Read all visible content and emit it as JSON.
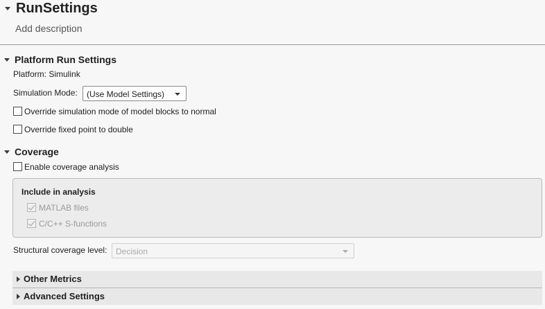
{
  "header": {
    "title": "RunSettings",
    "description": "Add description"
  },
  "platform_section": {
    "title": "Platform Run Settings",
    "platform_text": "Platform: Simulink",
    "simulation_mode_label": "Simulation Mode:",
    "simulation_mode_value": "(Use Model Settings)",
    "override_sim_mode_label": "Override simulation mode of model blocks to normal",
    "override_sim_mode_checked": false,
    "override_fixed_point_label": "Override fixed point to double",
    "override_fixed_point_checked": false
  },
  "coverage_section": {
    "title": "Coverage",
    "enable_label": "Enable coverage analysis",
    "enable_checked": false,
    "include_group": {
      "title": "Include in analysis",
      "matlab_files_label": "MATLAB files",
      "matlab_files_checked": true,
      "cpp_sfunctions_label": "C/C++ S-functions",
      "cpp_sfunctions_checked": true
    },
    "structural_level_label": "Structural coverage level:",
    "structural_level_value": "Decision"
  },
  "collapsed_sections": {
    "other_metrics": "Other Metrics",
    "advanced_settings": "Advanced Settings"
  }
}
